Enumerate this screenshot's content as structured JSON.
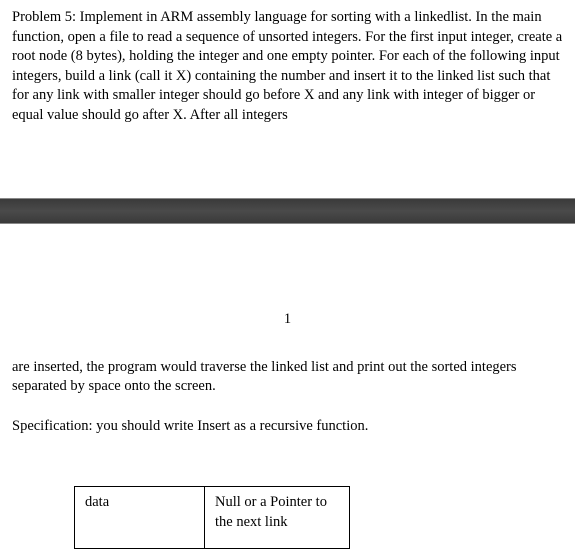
{
  "problem": {
    "heading_and_body": "Problem 5: Implement in ARM assembly language for sorting with a linkedlist. In the main function, open a file to read a sequence of unsorted integers. For the first input integer, create a root node (8 bytes), holding the integer and one empty pointer. For each of the following input integers, build a link (call it X) containing the number and insert it to the linked list such that for any link with smaller integer should go before X and any link with integer of bigger or equal value should go after X.  After all integers"
  },
  "page_number": "1",
  "continuation": "are inserted, the program would traverse the linked list and print out the sorted integers separated by space onto the screen.",
  "specification": "Specification: you should write Insert as a recursive function.",
  "node": {
    "data_label": "data",
    "next_label": "Null or a Pointer to the next link"
  }
}
